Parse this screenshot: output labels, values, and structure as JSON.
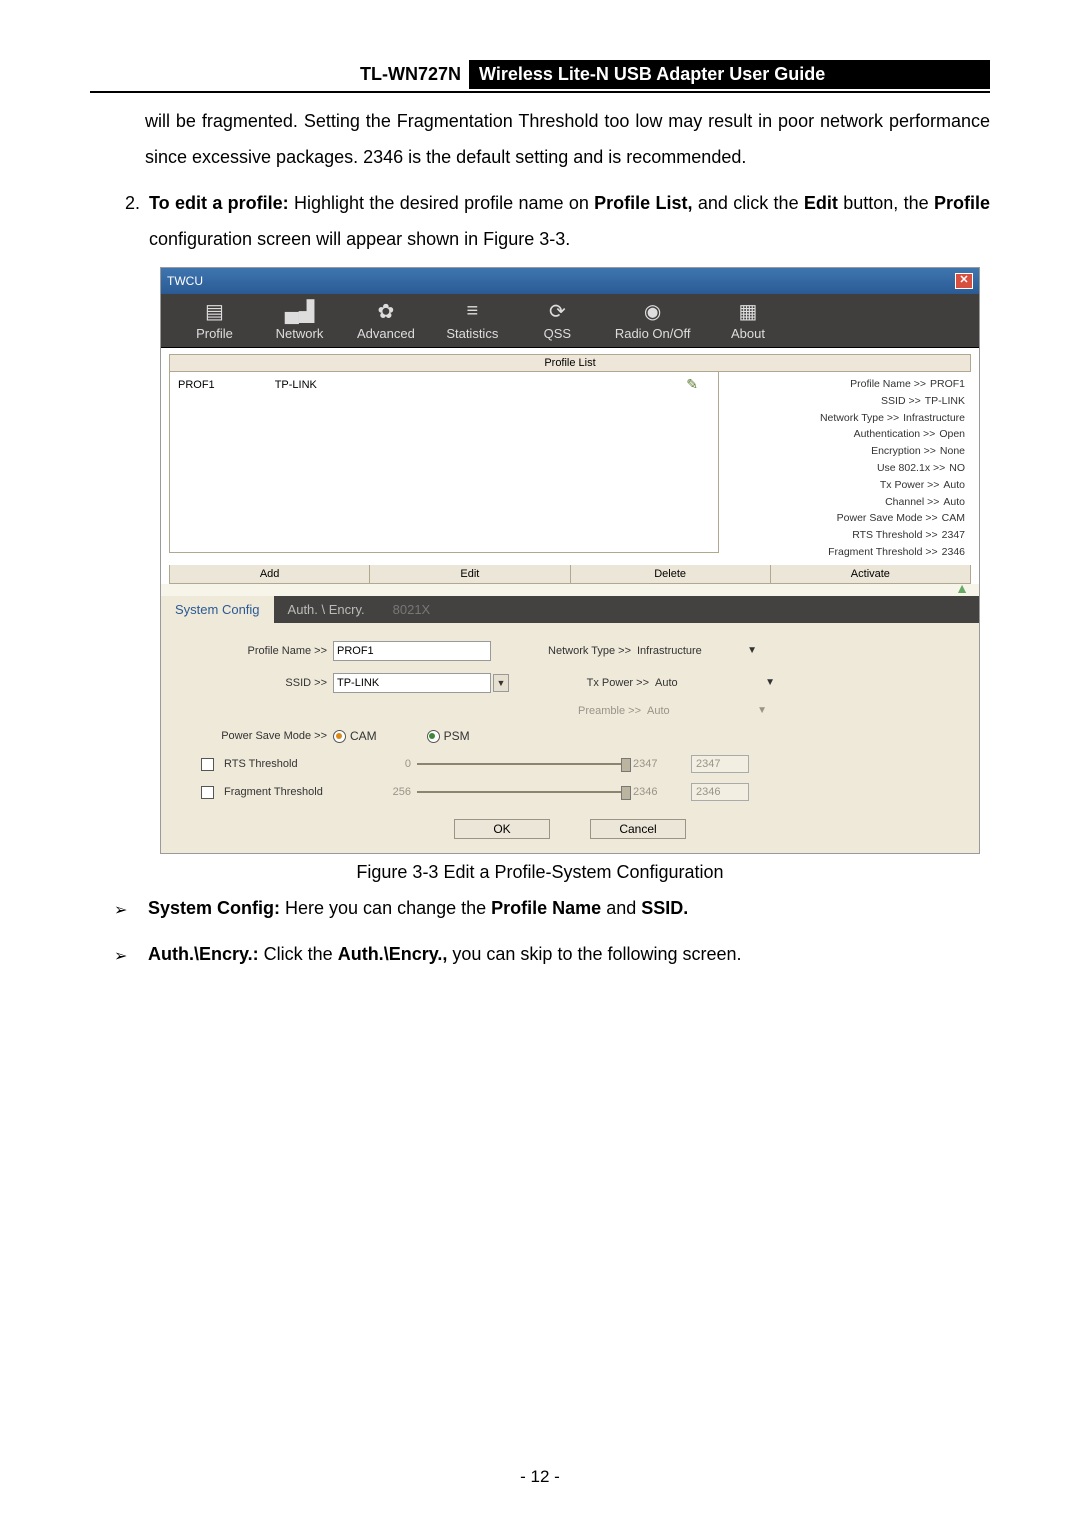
{
  "header": {
    "model": "TL-WN727N",
    "title": "Wireless Lite-N USB Adapter User Guide"
  },
  "para_cont": "will be fragmented. Setting the Fragmentation Threshold too low may result in poor network performance since excessive packages. 2346 is the default setting and is recommended.",
  "step2": {
    "lead": "To edit a profile:",
    "rest1": " Highlight the desired profile name on ",
    "b1": "Profile List,",
    "rest2": " and click the ",
    "b2": "Edit",
    "rest3": " button, the ",
    "b3": "Profile",
    "rest4": " configuration screen will appear shown in Figure 3-3."
  },
  "win": {
    "title": "TWCU",
    "close": "✕",
    "toolbar": [
      {
        "label": "Profile",
        "glyph": "▤"
      },
      {
        "label": "Network",
        "glyph": "▄▟"
      },
      {
        "label": "Advanced",
        "glyph": "✿"
      },
      {
        "label": "Statistics",
        "glyph": "≡"
      },
      {
        "label": "QSS",
        "glyph": "⟳"
      },
      {
        "label": "Radio On/Off",
        "glyph": "◉"
      },
      {
        "label": "About",
        "glyph": "▦"
      }
    ],
    "profile_list_header": "Profile List",
    "row": {
      "name": "PROF1",
      "ssid": "TP-LINK",
      "signal_glyph": "✎"
    },
    "details": [
      {
        "k": "Profile Name >>",
        "v": "PROF1"
      },
      {
        "k": "SSID >>",
        "v": "TP-LINK"
      },
      {
        "k": "Network Type >>",
        "v": "Infrastructure"
      },
      {
        "k": "Authentication >>",
        "v": "Open"
      },
      {
        "k": "Encryption >>",
        "v": "None"
      },
      {
        "k": "Use 802.1x >>",
        "v": "NO"
      },
      {
        "k": "Tx Power >>",
        "v": "Auto"
      },
      {
        "k": "Channel >>",
        "v": "Auto"
      },
      {
        "k": "Power Save Mode >>",
        "v": "CAM"
      },
      {
        "k": "RTS Threshold >>",
        "v": "2347"
      },
      {
        "k": "Fragment Threshold >>",
        "v": "2346"
      }
    ],
    "buttons": {
      "add": "Add",
      "edit": "Edit",
      "del": "Delete",
      "activate": "Activate"
    },
    "tabs": {
      "sys": "System Config",
      "auth": "Auth. \\ Encry.",
      "x": "8021X"
    },
    "cfg": {
      "profile_name_label": "Profile Name >>",
      "profile_name": "PROF1",
      "ssid_label": "SSID >>",
      "ssid": "TP-LINK",
      "nettype_label": "Network Type >>",
      "nettype": "Infrastructure",
      "txpower_label": "Tx Power >>",
      "txpower": "Auto",
      "preamble_label": "Preamble >>",
      "preamble": "Auto",
      "psm_label": "Power Save Mode >>",
      "psm_cam": "CAM",
      "psm_psm": "PSM",
      "rts_label": "RTS Threshold",
      "rts_min": "0",
      "rts_max": "2347",
      "rts_val": "2347",
      "frag_label": "Fragment Threshold",
      "frag_min": "256",
      "frag_max": "2346",
      "frag_val": "2346",
      "ok": "OK",
      "cancel": "Cancel"
    }
  },
  "figcap": "Figure 3-3 Edit a Profile-System Configuration",
  "bullets": {
    "sys_b": "System Config:",
    "sys_r": " Here you can change the ",
    "sys_pn": "Profile Name",
    "sys_and": " and ",
    "sys_ssid": "SSID.",
    "auth_b": "Auth.\\Encry.:",
    "auth_r1": " Click the ",
    "auth_b2": "Auth.\\Encry.,",
    "auth_r2": " you can skip to the following screen."
  },
  "page_num": "- 12 -"
}
